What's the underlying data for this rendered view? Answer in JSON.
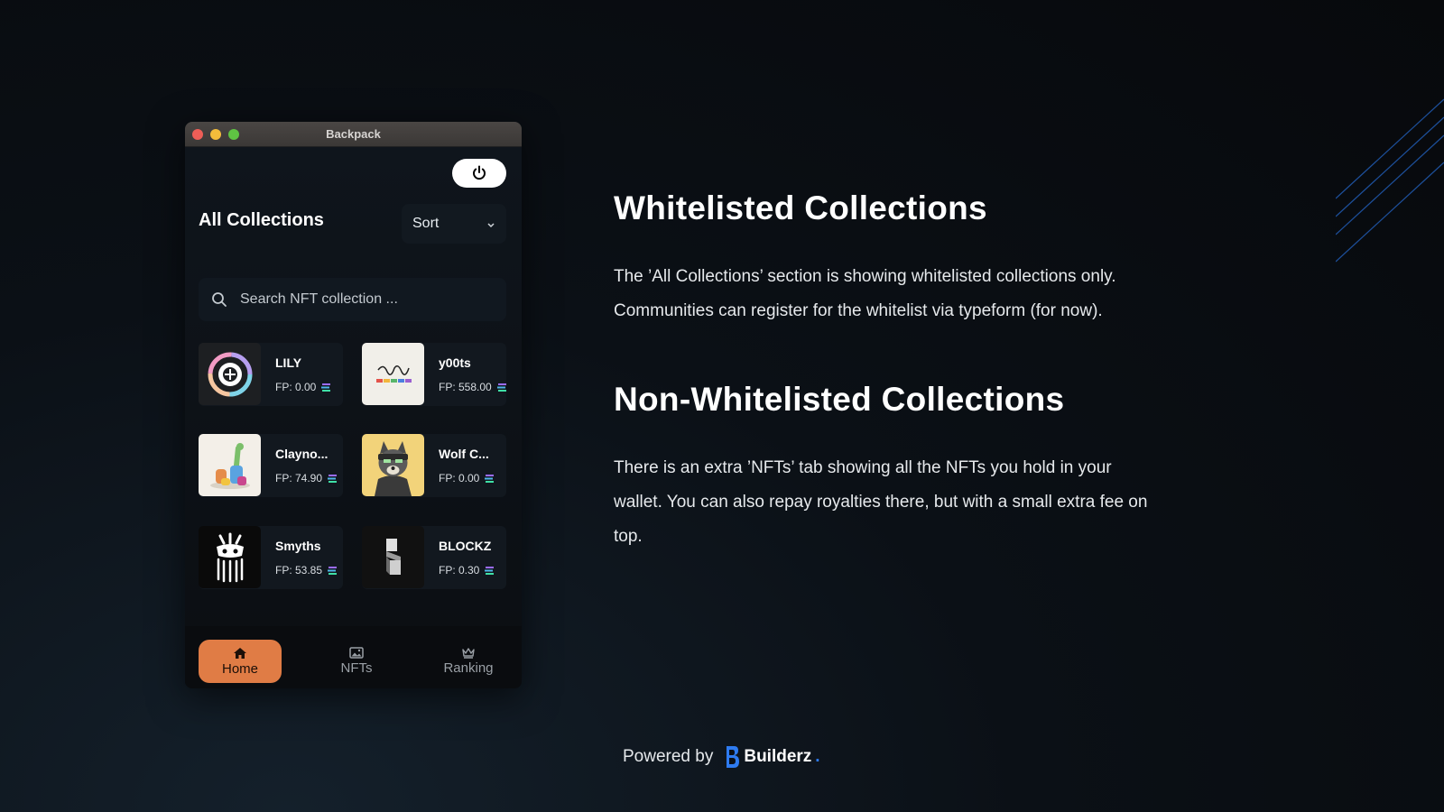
{
  "window": {
    "title": "Backpack"
  },
  "header": {
    "title": "All Collections",
    "sort_label": "Sort"
  },
  "search": {
    "placeholder": "Search NFT collection ..."
  },
  "collections": [
    {
      "name": "LILY",
      "fp": "FP: 0.00"
    },
    {
      "name": "y00ts",
      "fp": "FP: 558.00"
    },
    {
      "name": "Clayno...",
      "fp": "FP: 74.90"
    },
    {
      "name": "Wolf C...",
      "fp": "FP: 0.00"
    },
    {
      "name": "Smyths",
      "fp": "FP: 53.85"
    },
    {
      "name": "BLOCKZ",
      "fp": "FP: 0.30"
    }
  ],
  "nav": {
    "home": "Home",
    "nfts": "NFTs",
    "ranking": "Ranking"
  },
  "slide": {
    "heading_1": "Whitelisted Collections",
    "para_1": "The ’All Collections’ section is showing whitelisted collections only. Communities can register for the whitelist via typeform (for now).",
    "heading_2": "Non-Whitelisted Collections",
    "para_2": "There is an extra ’NFTs’ tab showing all the NFTs you hold in your wallet. You can also repay royalties there, but with a small extra fee on top."
  },
  "footer": {
    "powered_label": "Powered by",
    "brand": "Builderz",
    "brand_dot": "."
  },
  "colors": {
    "accent": "#e07c45",
    "brand_blue": "#2e7bf0"
  }
}
